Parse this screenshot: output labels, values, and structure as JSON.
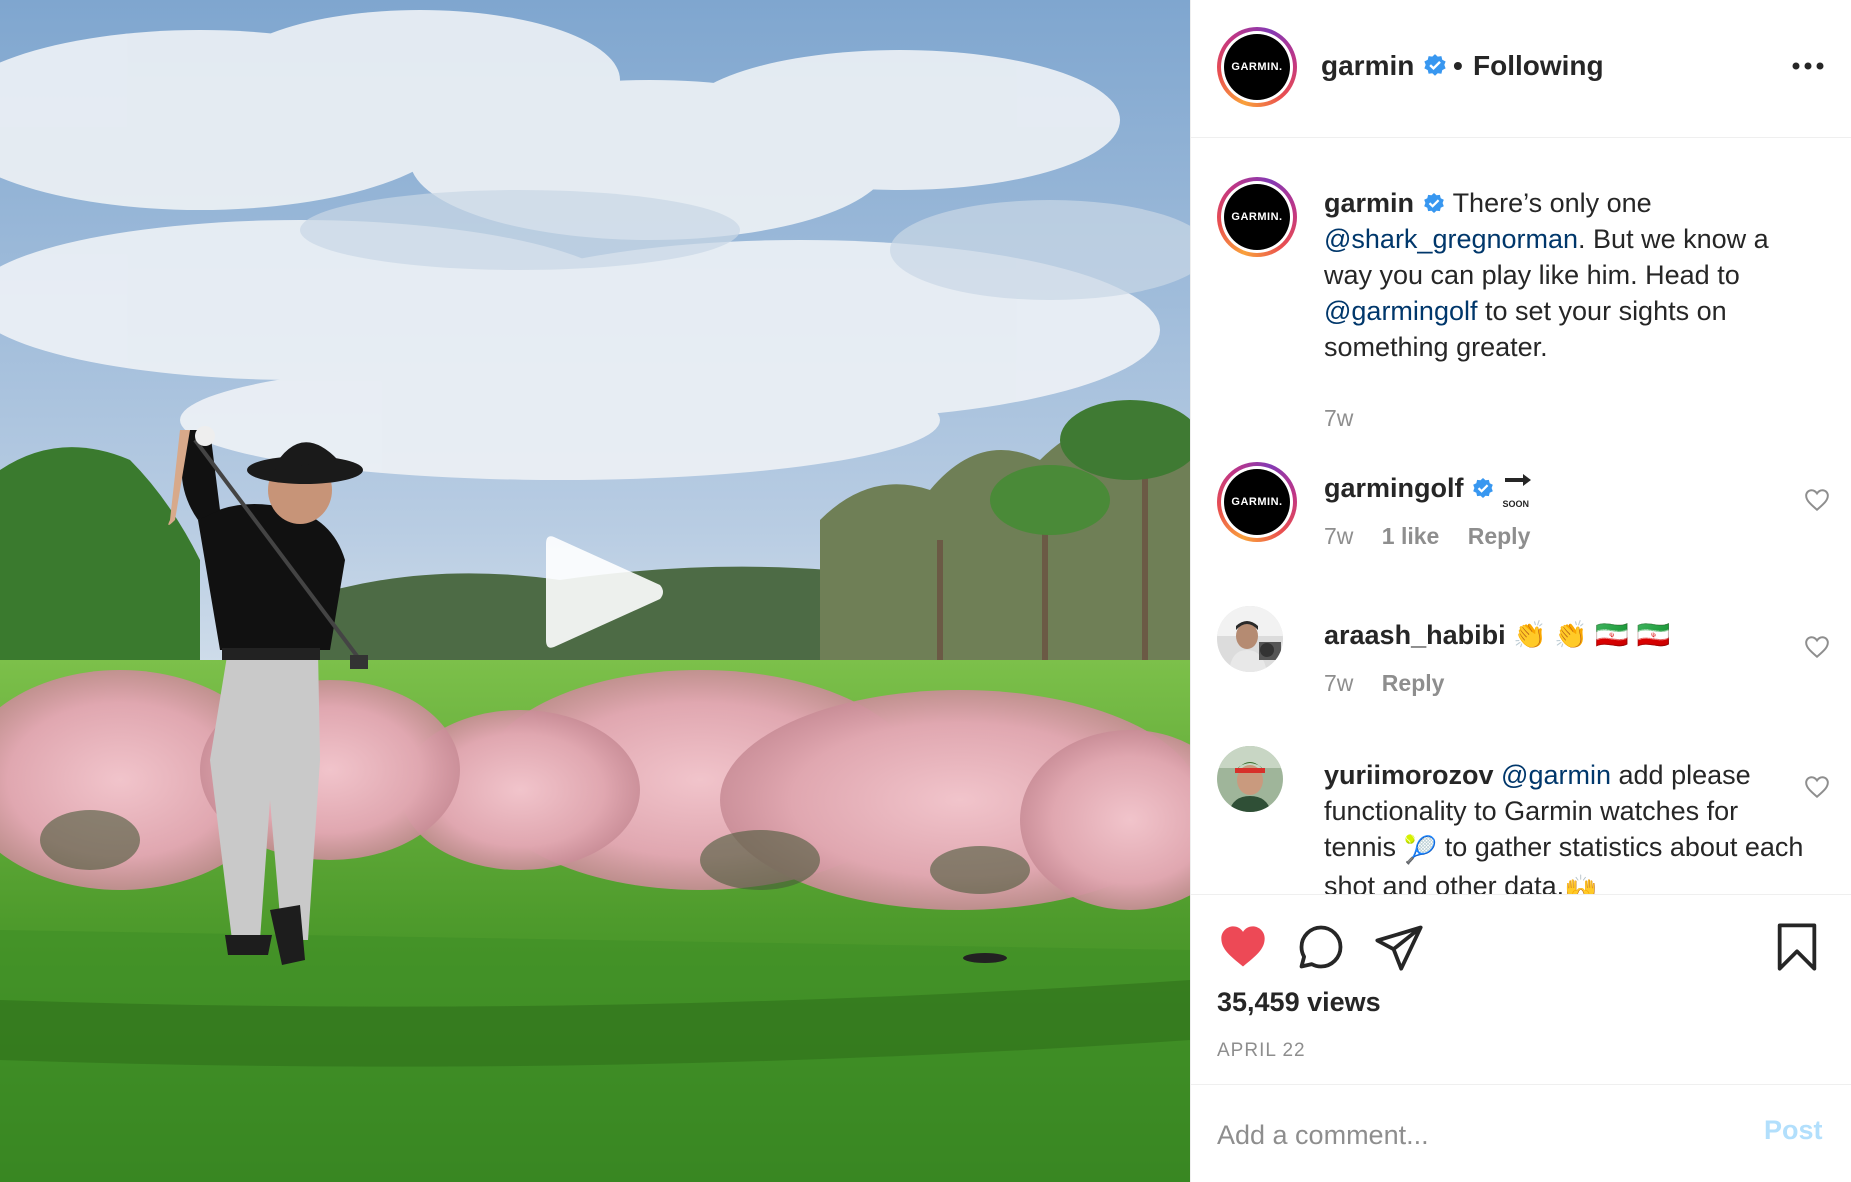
{
  "header": {
    "avatar_text": "GARMIN.",
    "username": "garmin",
    "separator": "•",
    "follow_status": "Following"
  },
  "caption": {
    "avatar_text": "GARMIN.",
    "username": "garmin",
    "text_1": "There’s only one",
    "mention_1": "@shark_gregnorman",
    "text_2": ". But we know a way you can play like him. Head to",
    "mention_2": "@garmingolf",
    "text_3": "to set your sights on something greater.",
    "time": "7w"
  },
  "comments": [
    {
      "avatar_text": "GARMIN.",
      "username": "garmingolf",
      "badge_text": "SOON",
      "time": "7w",
      "likes": "1 like",
      "reply": "Reply"
    },
    {
      "username": "araash_habibi",
      "text": "👏 👏 🇮🇷 🇮🇷",
      "time": "7w",
      "reply": "Reply"
    },
    {
      "username": "yuriimorozov",
      "mention": "@garmin",
      "text_1": "add please functionality to Garmin watches for tennis",
      "text_2": "to gather statistics about each shot and other data.",
      "emoji_ball": "🎾",
      "emoji_hands": "🙌"
    }
  ],
  "stats": {
    "views": "35,459 views",
    "date": "APRIL 22"
  },
  "add_comment": {
    "placeholder": "Add a comment...",
    "post_label": "Post"
  },
  "colors": {
    "like_red": "#ed4956",
    "verified_blue": "#3897f0",
    "mention": "#00376b",
    "muted": "#8e8e8e",
    "post_disabled": "#b2dffc"
  },
  "icons": {
    "play": "play-icon",
    "like": "heart-filled-icon",
    "comment": "comment-bubble-icon",
    "share": "paper-plane-icon",
    "save": "bookmark-icon",
    "more": "more-dots-icon"
  }
}
